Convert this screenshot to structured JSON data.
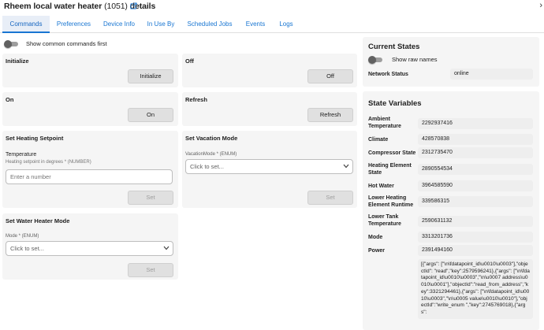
{
  "header": {
    "title_main": "Rheem local water heater",
    "title_id": "(1051)",
    "title_suffix": "details",
    "close_glyph": "›"
  },
  "tabs": [
    {
      "label": "Commands",
      "active": true
    },
    {
      "label": "Preferences",
      "active": false
    },
    {
      "label": "Device Info",
      "active": false
    },
    {
      "label": "In Use By",
      "active": false
    },
    {
      "label": "Scheduled Jobs",
      "active": false
    },
    {
      "label": "Events",
      "active": false
    },
    {
      "label": "Logs",
      "active": false
    }
  ],
  "commands": {
    "common_first_label": "Show common commands first",
    "initialize": {
      "title": "Initialize",
      "button": "Initialize"
    },
    "off": {
      "title": "Off",
      "button": "Off"
    },
    "on": {
      "title": "On",
      "button": "On"
    },
    "refresh": {
      "title": "Refresh",
      "button": "Refresh"
    },
    "set_heating_setpoint": {
      "title": "Set Heating Setpoint",
      "field_label": "Temperature",
      "field_sub": "Heating setpoint in degrees * (NUMBER)",
      "placeholder": "Enter a number",
      "button": "Set"
    },
    "set_vacation_mode": {
      "title": "Set Vacation Mode",
      "select_label": "VacationMode * (ENUM)",
      "select_value": "Click to set...",
      "button": "Set"
    },
    "set_water_heater_mode": {
      "title": "Set Water Heater Mode",
      "select_label": "Mode * (ENUM)",
      "select_value": "Click to set...",
      "button": "Set"
    }
  },
  "current_states": {
    "title": "Current States",
    "raw_names_label": "Show raw names",
    "network_status_label": "Network Status",
    "network_status_value": "online"
  },
  "state_variables": {
    "title": "State Variables",
    "items": [
      {
        "name": "Ambient Temperature",
        "value": "2292937416"
      },
      {
        "name": "Climate",
        "value": "428570838"
      },
      {
        "name": "Compressor State",
        "value": "2312735470"
      },
      {
        "name": "Heating Element State",
        "value": "2890554534"
      },
      {
        "name": "Hot Water",
        "value": "3964585590"
      },
      {
        "name": "Lower Heating Element Runtime",
        "value": "339586315"
      },
      {
        "name": "Lower Tank Temperature",
        "value": "2590631132"
      },
      {
        "name": "Mode",
        "value": "3313201736"
      },
      {
        "name": "Power",
        "value": "2391494160"
      }
    ],
    "raw_value": "[{\"args\": [\"\\n\\fdatapoint_id\\u0010\\u0003\"],\"objectId\": \"read\",\"key\":2579596241},{\"args\": [\"\\n\\fdatapoint_id\\u0010\\u0003\",\"\\n\\u0007 address\\u0010\\u0001\"],\"objectId\":\"read_from_address\",\"key\":3321294461},{\"args\": [\"\\n\\fdatapoint_id\\u0010\\u0003\",\"\\n\\u0005 value\\u0010\\u0010\"],\"objectId\":\"write_enum \",\"key\":2745769018},{\"args\":"
  },
  "colors": {
    "accent": "#1976d2",
    "card_bg": "#f5f5f5",
    "button_bg": "#e0e0e0",
    "tab_active_bg": "#e8eef7"
  }
}
